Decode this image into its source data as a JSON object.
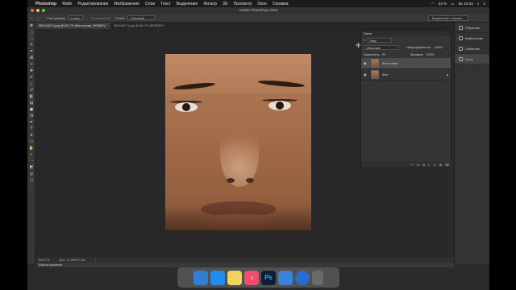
{
  "menubar": {
    "apple": "",
    "items": [
      "Photoshop",
      "Файл",
      "Редактирование",
      "Изображение",
      "Слои",
      "Текст",
      "Выделение",
      "Фильтр",
      "3D",
      "Просмотр",
      "Окно",
      "Справка"
    ],
    "battery": "33 %",
    "clock": "Вс 10:23"
  },
  "window": {
    "title": "Adobe Photoshop 2020"
  },
  "options": {
    "feather_label": "Растушевка:",
    "feather_value": "0 пикс.",
    "antialias": "Сглаживание",
    "style_label": "Стиль:",
    "style_value": "Обычный",
    "select_mask_button": "Выделение и маска..."
  },
  "tabs": [
    {
      "label": "281118171.jpg @ 66,7% (Фон копия, RGB/8*) *",
      "active": true
    },
    {
      "label": "281118171.jpg @ 66,7% (RGB/8*) *",
      "active": false
    }
  ],
  "layers": {
    "panel_title": "Слои",
    "filter": "Вид",
    "blend_mode": "Обычные",
    "opacity_label": "Непрозрачность:",
    "opacity_value": "100%",
    "lock_label": "Закрепить:",
    "fill_label": "Заливка:",
    "fill_value": "100%",
    "items": [
      {
        "name": "Фон копия",
        "selected": true
      },
      {
        "name": "Фон",
        "selected": false
      }
    ],
    "footer_icons": [
      "link-icon",
      "fx-icon",
      "mask-icon",
      "adjustment-icon",
      "group-icon",
      "new-layer-icon",
      "trash-icon"
    ]
  },
  "right_panel": {
    "items": [
      "Обучение",
      "Библиотеки",
      "Свойства",
      "Слои"
    ]
  },
  "status": {
    "zoom": "66,67%",
    "doc": "Док: 4,78М/37,6М"
  },
  "timeline": {
    "label": "Шкала времени"
  },
  "dock": {
    "icons": [
      {
        "name": "finder-icon",
        "label": "",
        "color": "#2f7fd6"
      },
      {
        "name": "safari-icon",
        "label": "",
        "color": "#1f8ef0"
      },
      {
        "name": "notes-icon",
        "label": "",
        "color": "#f2d45a"
      },
      {
        "name": "music-icon",
        "label": "♪",
        "color": "#f24d6b"
      },
      {
        "name": "photoshop-icon",
        "label": "Ps",
        "color": "#0a1f33"
      },
      {
        "name": "keychain-icon",
        "label": "",
        "color": "#3a82d8"
      },
      {
        "name": "chrome-icon",
        "label": "",
        "color": "#2a6bd0"
      },
      {
        "name": "trash-icon",
        "label": "",
        "color": "#6a6a6a"
      }
    ]
  }
}
